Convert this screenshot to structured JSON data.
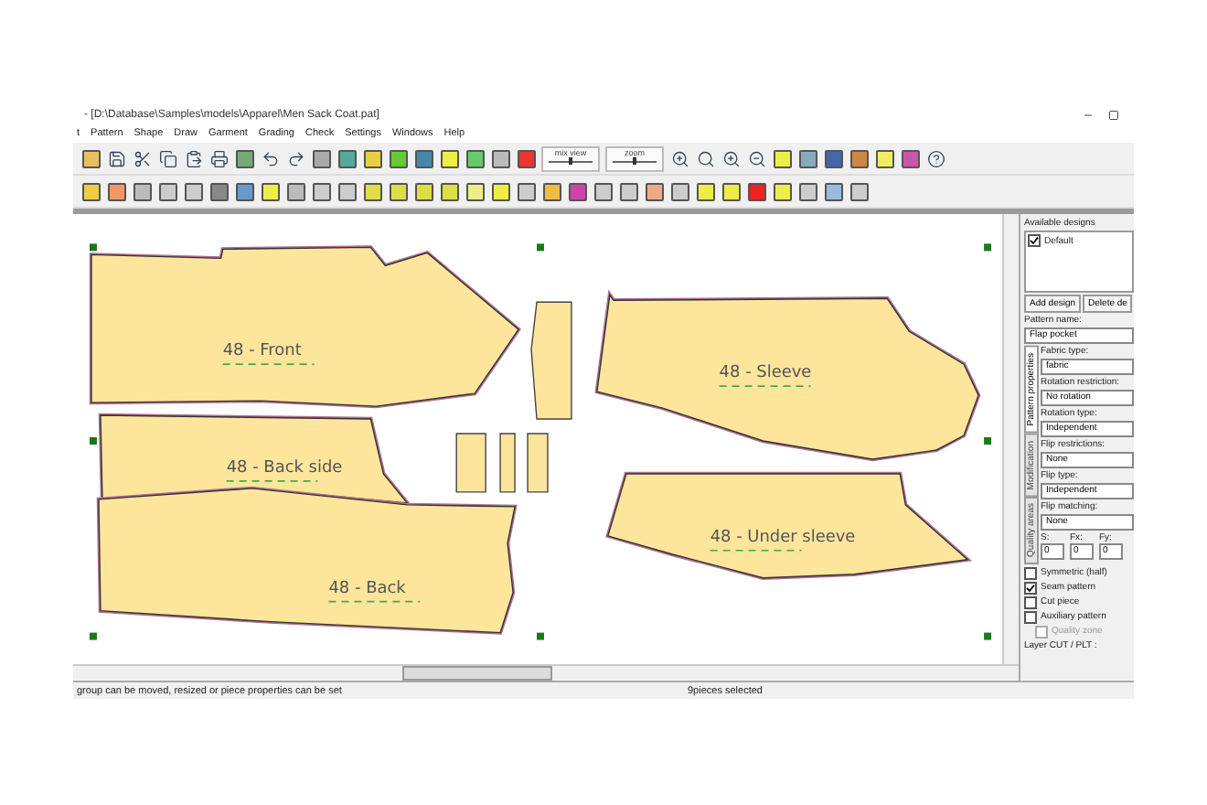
{
  "window": {
    "title": "- [D:\\Database\\Samples\\models\\Apparel\\Men Sack Coat.pat]"
  },
  "menu": [
    "t",
    "Pattern",
    "Shape",
    "Draw",
    "Garment",
    "Grading",
    "Check",
    "Settings",
    "Windows",
    "Help"
  ],
  "toolbar": {
    "sliders": [
      {
        "label": "mix view",
        "level": 0.5
      },
      {
        "label": "zoom",
        "level": 0.5
      }
    ]
  },
  "canvas": {
    "pieces": [
      {
        "label": "48 - Front"
      },
      {
        "label": "48 - Back side"
      },
      {
        "label": "48 - Back"
      },
      {
        "label": "48 - Sleeve"
      },
      {
        "label": "48 - Under sleeve"
      }
    ]
  },
  "panel": {
    "designs_title": "Available designs",
    "designs": [
      {
        "name": "Default",
        "checked": true
      }
    ],
    "buttons": [
      "Add design",
      "Delete de"
    ],
    "pattern_name_label": "Pattern name:",
    "pattern_name": "Flap pocket",
    "tabs": [
      {
        "label": "Pattern properties",
        "selected": true
      },
      {
        "label": "Modification",
        "selected": false
      },
      {
        "label": "Quality areas",
        "selected": false
      }
    ],
    "fields": [
      {
        "label": "Fabric type:",
        "value": "fabric"
      },
      {
        "label": "Rotation restriction:",
        "value": "No rotation"
      },
      {
        "label": "Rotation type:",
        "value": "Independent"
      },
      {
        "label": "Flip restrictions:",
        "value": "None"
      },
      {
        "label": "Flip type:",
        "value": "Independent"
      },
      {
        "label": "Flip matching:",
        "value": "None"
      }
    ],
    "numbers": [
      {
        "label": "S:",
        "value": "0"
      },
      {
        "label": "Fx:",
        "value": "0"
      },
      {
        "label": "Fy:",
        "value": "0"
      }
    ],
    "checkboxes": [
      {
        "label": "Symmetric (half)",
        "checked": false,
        "disabled": false
      },
      {
        "label": "Seam pattern",
        "checked": true,
        "disabled": false
      },
      {
        "label": "Cut piece",
        "checked": false,
        "disabled": false
      },
      {
        "label": "Auxiliary pattern",
        "checked": false,
        "disabled": false
      },
      {
        "label": "Quality zone",
        "checked": false,
        "disabled": true
      }
    ],
    "layer_label": "Layer CUT / PLT :"
  },
  "status_bar": {
    "hint": "group can be moved, resized or piece properties can be set",
    "selection": "9pieces selected"
  }
}
